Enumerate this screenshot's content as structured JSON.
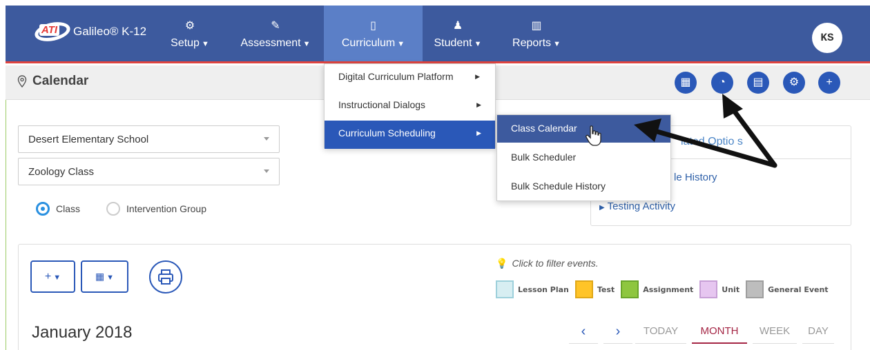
{
  "brand": {
    "name": "Galileo® K-12",
    "logo_text": "ATI"
  },
  "nav": [
    {
      "icon": "gear-icon",
      "glyph": "⚙",
      "label": "Setup"
    },
    {
      "icon": "edit-icon",
      "glyph": "✎",
      "label": "Assessment"
    },
    {
      "icon": "book-icon",
      "glyph": "▯",
      "label": "Curriculum"
    },
    {
      "icon": "student-icon",
      "glyph": "♟",
      "label": "Student"
    },
    {
      "icon": "bar-chart-icon",
      "glyph": "▥",
      "label": "Reports"
    }
  ],
  "user": {
    "initials": "KS"
  },
  "page": {
    "title": "Calendar"
  },
  "toolbar": {
    "buttons": [
      "grid-icon",
      "dashboard-icon",
      "calendar-icon",
      "gear-icon",
      "plus-icon"
    ]
  },
  "filters": {
    "school": "Desert Elementary School",
    "class": "Zoology Class",
    "radio_class": "Class",
    "radio_intervention": "Intervention Group"
  },
  "related": {
    "header": "Related Options",
    "header_visible": "lated Optio s",
    "link_schedule_history": "le History",
    "link_testing_activity": "Testing Activity"
  },
  "curriculum_menu": [
    {
      "label": "Digital Curriculum Platform"
    },
    {
      "label": "Instructional Dialogs"
    },
    {
      "label": "Curriculum Scheduling"
    }
  ],
  "scheduling_submenu": [
    {
      "label": "Class Calendar"
    },
    {
      "label": "Bulk Scheduler"
    },
    {
      "label": "Bulk Schedule History"
    }
  ],
  "calendar": {
    "filter_hint": "Click to filter events.",
    "legend": [
      {
        "label": "Lesson Plan",
        "fill": "#d7eef2",
        "border": "#9dd0db"
      },
      {
        "label": "Test",
        "fill": "#ffc428",
        "border": "#e0a818"
      },
      {
        "label": "Assignment",
        "fill": "#8ec63f",
        "border": "#6aa52a"
      },
      {
        "label": "Unit",
        "fill": "#e6c6f0",
        "border": "#c79fd6"
      },
      {
        "label": "General Event",
        "fill": "#bdbdbd",
        "border": "#9e9e9e"
      }
    ],
    "month": "January 2018",
    "views": {
      "today": "TODAY",
      "month": "MONTH",
      "week": "WEEK",
      "day": "DAY"
    }
  },
  "colors": {
    "navbar": "#3d5a9e",
    "accent": "#2a58b8",
    "active_view": "#a42544"
  }
}
